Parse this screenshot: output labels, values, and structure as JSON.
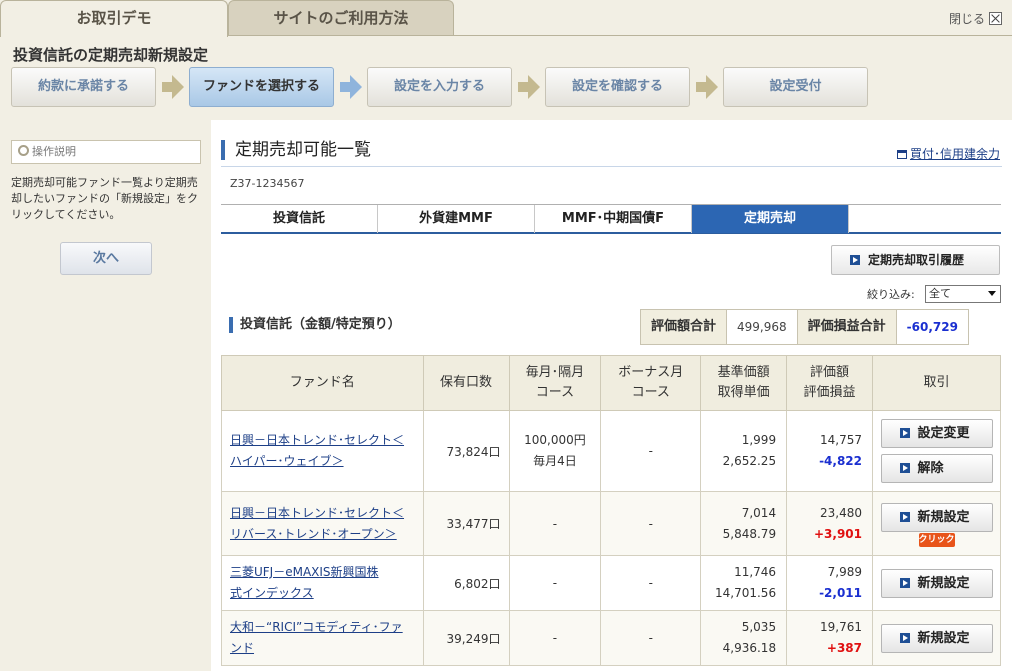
{
  "tabs": {
    "demo": "お取引デモ",
    "howto": "サイトのご利用方法",
    "close": "閉じる"
  },
  "page_title": "投資信託の定期売却新規設定",
  "steps": [
    "約款に承諾する",
    "ファンドを選択する",
    "設定を入力する",
    "設定を確認する",
    "設定受付"
  ],
  "sidebar": {
    "help_title": "操作説明",
    "help_text": "定期売却可能ファンド一覧より定期売却したいファンドの「新規設定」をクリックしてください。",
    "next": "次へ"
  },
  "main": {
    "title": "定期売却可能一覧",
    "credit_link": "買付･信用建余力",
    "account": "Z37-1234567",
    "subtabs": [
      "投資信託",
      "外貨建MMF",
      "MMF･中期国債F",
      "定期売却"
    ],
    "history_button": "定期売却取引履歴",
    "filter_label": "絞り込み:",
    "filter_value": "全て",
    "section_title": "投資信託（金額/特定預り）",
    "summary": {
      "eval_label": "評価額合計",
      "eval_value": "499,968",
      "pl_label": "評価損益合計",
      "pl_value": "-60,729"
    }
  },
  "table": {
    "headers": {
      "fund": "ファンド名",
      "units": "保有口数",
      "monthly1": "毎月･隔月",
      "monthly2": "コース",
      "bonus1": "ボーナス月",
      "bonus2": "コース",
      "price1": "基準価額",
      "price2": "取得単価",
      "eval1": "評価額",
      "eval2": "評価損益",
      "trade": "取引"
    },
    "rows": [
      {
        "name1": "日興－日本トレンド･セレクト＜",
        "name2": "ハイパー･ウェイブ＞",
        "units": "73,824口",
        "monthly1": "100,000円",
        "monthly2": "毎月4日",
        "bonus": "-",
        "price": "1,999",
        "cost": "2,652.25",
        "eval": "14,757",
        "pl": "-4,822",
        "action1": "設定変更",
        "action2": "解除"
      },
      {
        "name1": "日興－日本トレンド･セレクト＜",
        "name2": "リバース･トレンド･オープン＞",
        "units": "33,477口",
        "monthly1": "-",
        "bonus": "-",
        "price": "7,014",
        "cost": "5,848.79",
        "eval": "23,480",
        "pl": "+3,901",
        "action1": "新規設定",
        "badge": "クリック"
      },
      {
        "name1": "三菱UFJ－eMAXIS新興国株",
        "name2": "式インデックス",
        "units": "6,802口",
        "monthly1": "-",
        "bonus": "-",
        "price": "11,746",
        "cost": "14,701.56",
        "eval": "7,989",
        "pl": "-2,011",
        "action1": "新規設定"
      },
      {
        "name1": "大和－“RICI”コモディティ･ファ",
        "name2": "ンド",
        "units": "39,249口",
        "monthly1": "-",
        "bonus": "-",
        "price": "5,035",
        "cost": "4,936.18",
        "eval": "19,761",
        "pl": "+387",
        "action1": "新規設定"
      }
    ]
  }
}
